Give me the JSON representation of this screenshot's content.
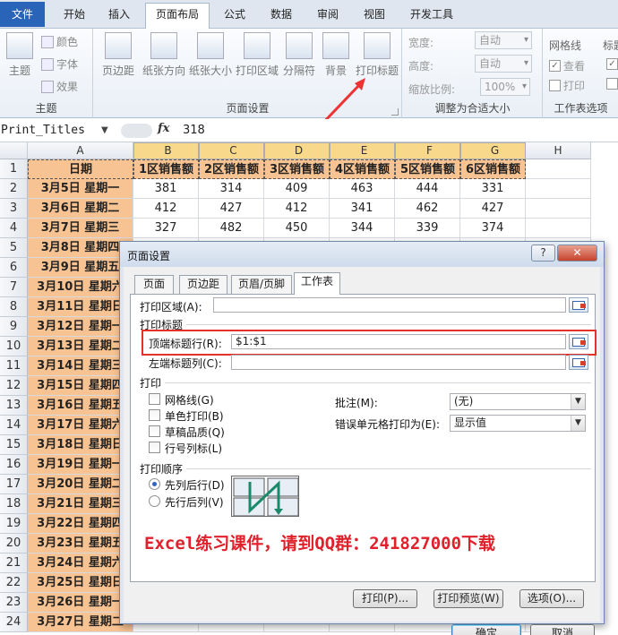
{
  "tabs": [
    "文件",
    "开始",
    "插入",
    "页面布局",
    "公式",
    "数据",
    "审阅",
    "视图",
    "开发工具"
  ],
  "ribbon": {
    "theme_group": {
      "label": "主题",
      "theme_btn": "主题",
      "colors": "颜色",
      "fonts": "字体",
      "effects": "效果"
    },
    "page_setup_group": {
      "label": "页面设置",
      "margins": "页边距",
      "orientation": "纸张方向",
      "size": "纸张大小",
      "print_area": "打印区域",
      "breaks": "分隔符",
      "background": "背景",
      "print_titles": "打印标题"
    },
    "scale_group": {
      "label": "调整为合适大小",
      "width_label": "宽度:",
      "width_value": "自动",
      "height_label": "高度:",
      "height_value": "自动",
      "scale_label": "缩放比例:",
      "scale_value": "100%"
    },
    "sheet_options_group": {
      "label": "工作表选项",
      "gridlines": "网格线",
      "headings": "标题",
      "view": "查看",
      "print": "打印"
    }
  },
  "formula_bar": {
    "name_box": "Print_Titles",
    "fx": "fx",
    "value": "318"
  },
  "sheet": {
    "columns": [
      "A",
      "B",
      "C",
      "D",
      "E",
      "F",
      "G",
      "H"
    ],
    "header_row": [
      "日期",
      "1区销售额",
      "2区销售额",
      "3区销售额",
      "4区销售额",
      "5区销售额",
      "6区销售额"
    ],
    "dates": [
      "3月5日 星期一",
      "3月6日 星期二",
      "3月7日 星期三",
      "3月8日 星期四",
      "3月9日 星期五",
      "3月10日 星期六",
      "3月11日 星期日",
      "3月12日 星期一",
      "3月13日 星期二",
      "3月14日 星期三",
      "3月15日 星期四",
      "3月16日 星期五",
      "3月17日 星期六",
      "3月18日 星期日",
      "3月19日 星期一",
      "3月20日 星期二",
      "3月21日 星期三",
      "3月22日 星期四",
      "3月23日 星期五",
      "3月24日 星期六",
      "3月25日 星期日",
      "3月26日 星期一",
      "3月27日 星期二"
    ],
    "values": [
      [
        "381",
        "314",
        "409",
        "463",
        "444",
        "331"
      ],
      [
        "412",
        "427",
        "412",
        "341",
        "462",
        "427"
      ],
      [
        "327",
        "482",
        "450",
        "344",
        "339",
        "374"
      ]
    ]
  },
  "dialog": {
    "title": "页面设置",
    "help": "?",
    "close": "✕",
    "tabs": [
      "页面",
      "页边距",
      "页眉/页脚",
      "工作表"
    ],
    "print_area_label": "打印区域(A):",
    "print_titles_section": "打印标题",
    "top_rows_label": "顶端标题行(R):",
    "top_rows_value": "$1:$1",
    "left_cols_label": "左端标题列(C):",
    "print_section": "打印",
    "gridlines": "网格线(G)",
    "black_white": "单色打印(B)",
    "draft": "草稿品质(Q)",
    "row_col_headings": "行号列标(L)",
    "comments_label": "批注(M):",
    "comments_value": "(无)",
    "errors_label": "错误单元格打印为(E):",
    "errors_value": "显示值",
    "order_section": "打印顺序",
    "down_then_over": "先列后行(D)",
    "over_then_down": "先行后列(V)",
    "print_btn": "打印(P)...",
    "preview_btn": "打印预览(W)",
    "options_btn": "选项(O)...",
    "ok_btn": "确定",
    "cancel_btn": "取消"
  },
  "promo": "Excel练习课件，请到QQ群：241827000下载"
}
